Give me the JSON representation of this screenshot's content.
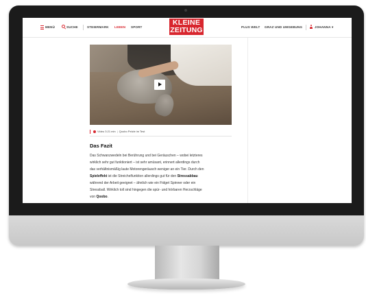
{
  "nav": {
    "menu_label": "Menü",
    "search_label": "Suche",
    "items": [
      {
        "label": "Steiermark"
      },
      {
        "label": "Leben"
      },
      {
        "label": "Sport"
      }
    ],
    "active_index": 1,
    "right_items": [
      {
        "label": "Plus Welt"
      },
      {
        "label": "Graz und Umgebung"
      }
    ],
    "user_label": "Johanna",
    "user_caret": "▾"
  },
  "logo": {
    "line1": "KLEINE",
    "line2": "ZEITUNG"
  },
  "colors": {
    "brand_red": "#d8262e"
  },
  "icons": {
    "menu": "hamburger-icon",
    "search": "search-icon",
    "user": "user-icon",
    "play": "play-icon",
    "caption": "video-dot-icon"
  },
  "video": {
    "caption_duration": "Video 3:21 min",
    "caption_title": "Qoobo Pelzle im Test"
  },
  "article": {
    "heading": "Das Fazit",
    "lines": [
      {
        "parts": [
          {
            "t": "Das Schwanzwedeln bei Berührung und bei Geräuschen – wobei letzteres"
          }
        ]
      },
      {
        "parts": [
          {
            "t": "wirklich sehr gut funktioniert – ist sehr amüsant, erinnert allerdings durch"
          }
        ]
      },
      {
        "parts": [
          {
            "t": "das verhältnismäßig laute Motorengeräusch weniger an ein Tier. Durch den"
          }
        ]
      },
      {
        "parts": [
          {
            "t": "Spieleffekt",
            "b": true
          },
          {
            "t": " ist die Streichelfunktion allerdings gut für den "
          },
          {
            "t": "Stressabbau",
            "b": true
          }
        ]
      },
      {
        "parts": [
          {
            "t": "während der Arbeit geeignet – ähnlich wie ein Fidget Spinner oder ein"
          }
        ]
      },
      {
        "parts": [
          {
            "t": "Stressball. Wirklich toll sind hingegen die spür- und hörbaren Herzschläge"
          }
        ]
      },
      {
        "parts": [
          {
            "t": "von "
          },
          {
            "t": "Qoobo",
            "b": true
          },
          {
            "t": "."
          }
        ]
      }
    ]
  }
}
